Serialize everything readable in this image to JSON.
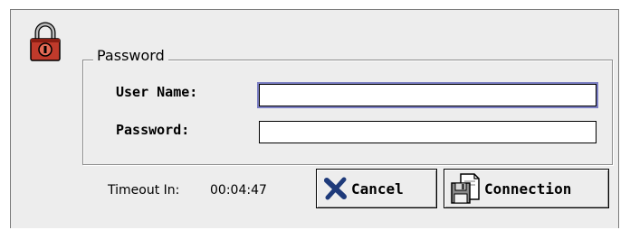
{
  "icons": {
    "lock": "padlock-icon",
    "cancel": "x-icon",
    "connection": "disk-document-icon"
  },
  "colors": {
    "lock_body": "#c03a2b",
    "focus_ring": "#7b7fc4",
    "cancel_x": "#1e3a7a"
  },
  "group": {
    "title": "Password"
  },
  "fields": {
    "username": {
      "label": "User Name:",
      "value": ""
    },
    "password": {
      "label": "Password:",
      "value": ""
    }
  },
  "timeout": {
    "label": "Timeout In:",
    "value": "00:04:47"
  },
  "buttons": {
    "cancel": "Cancel",
    "connection": "Connection"
  }
}
